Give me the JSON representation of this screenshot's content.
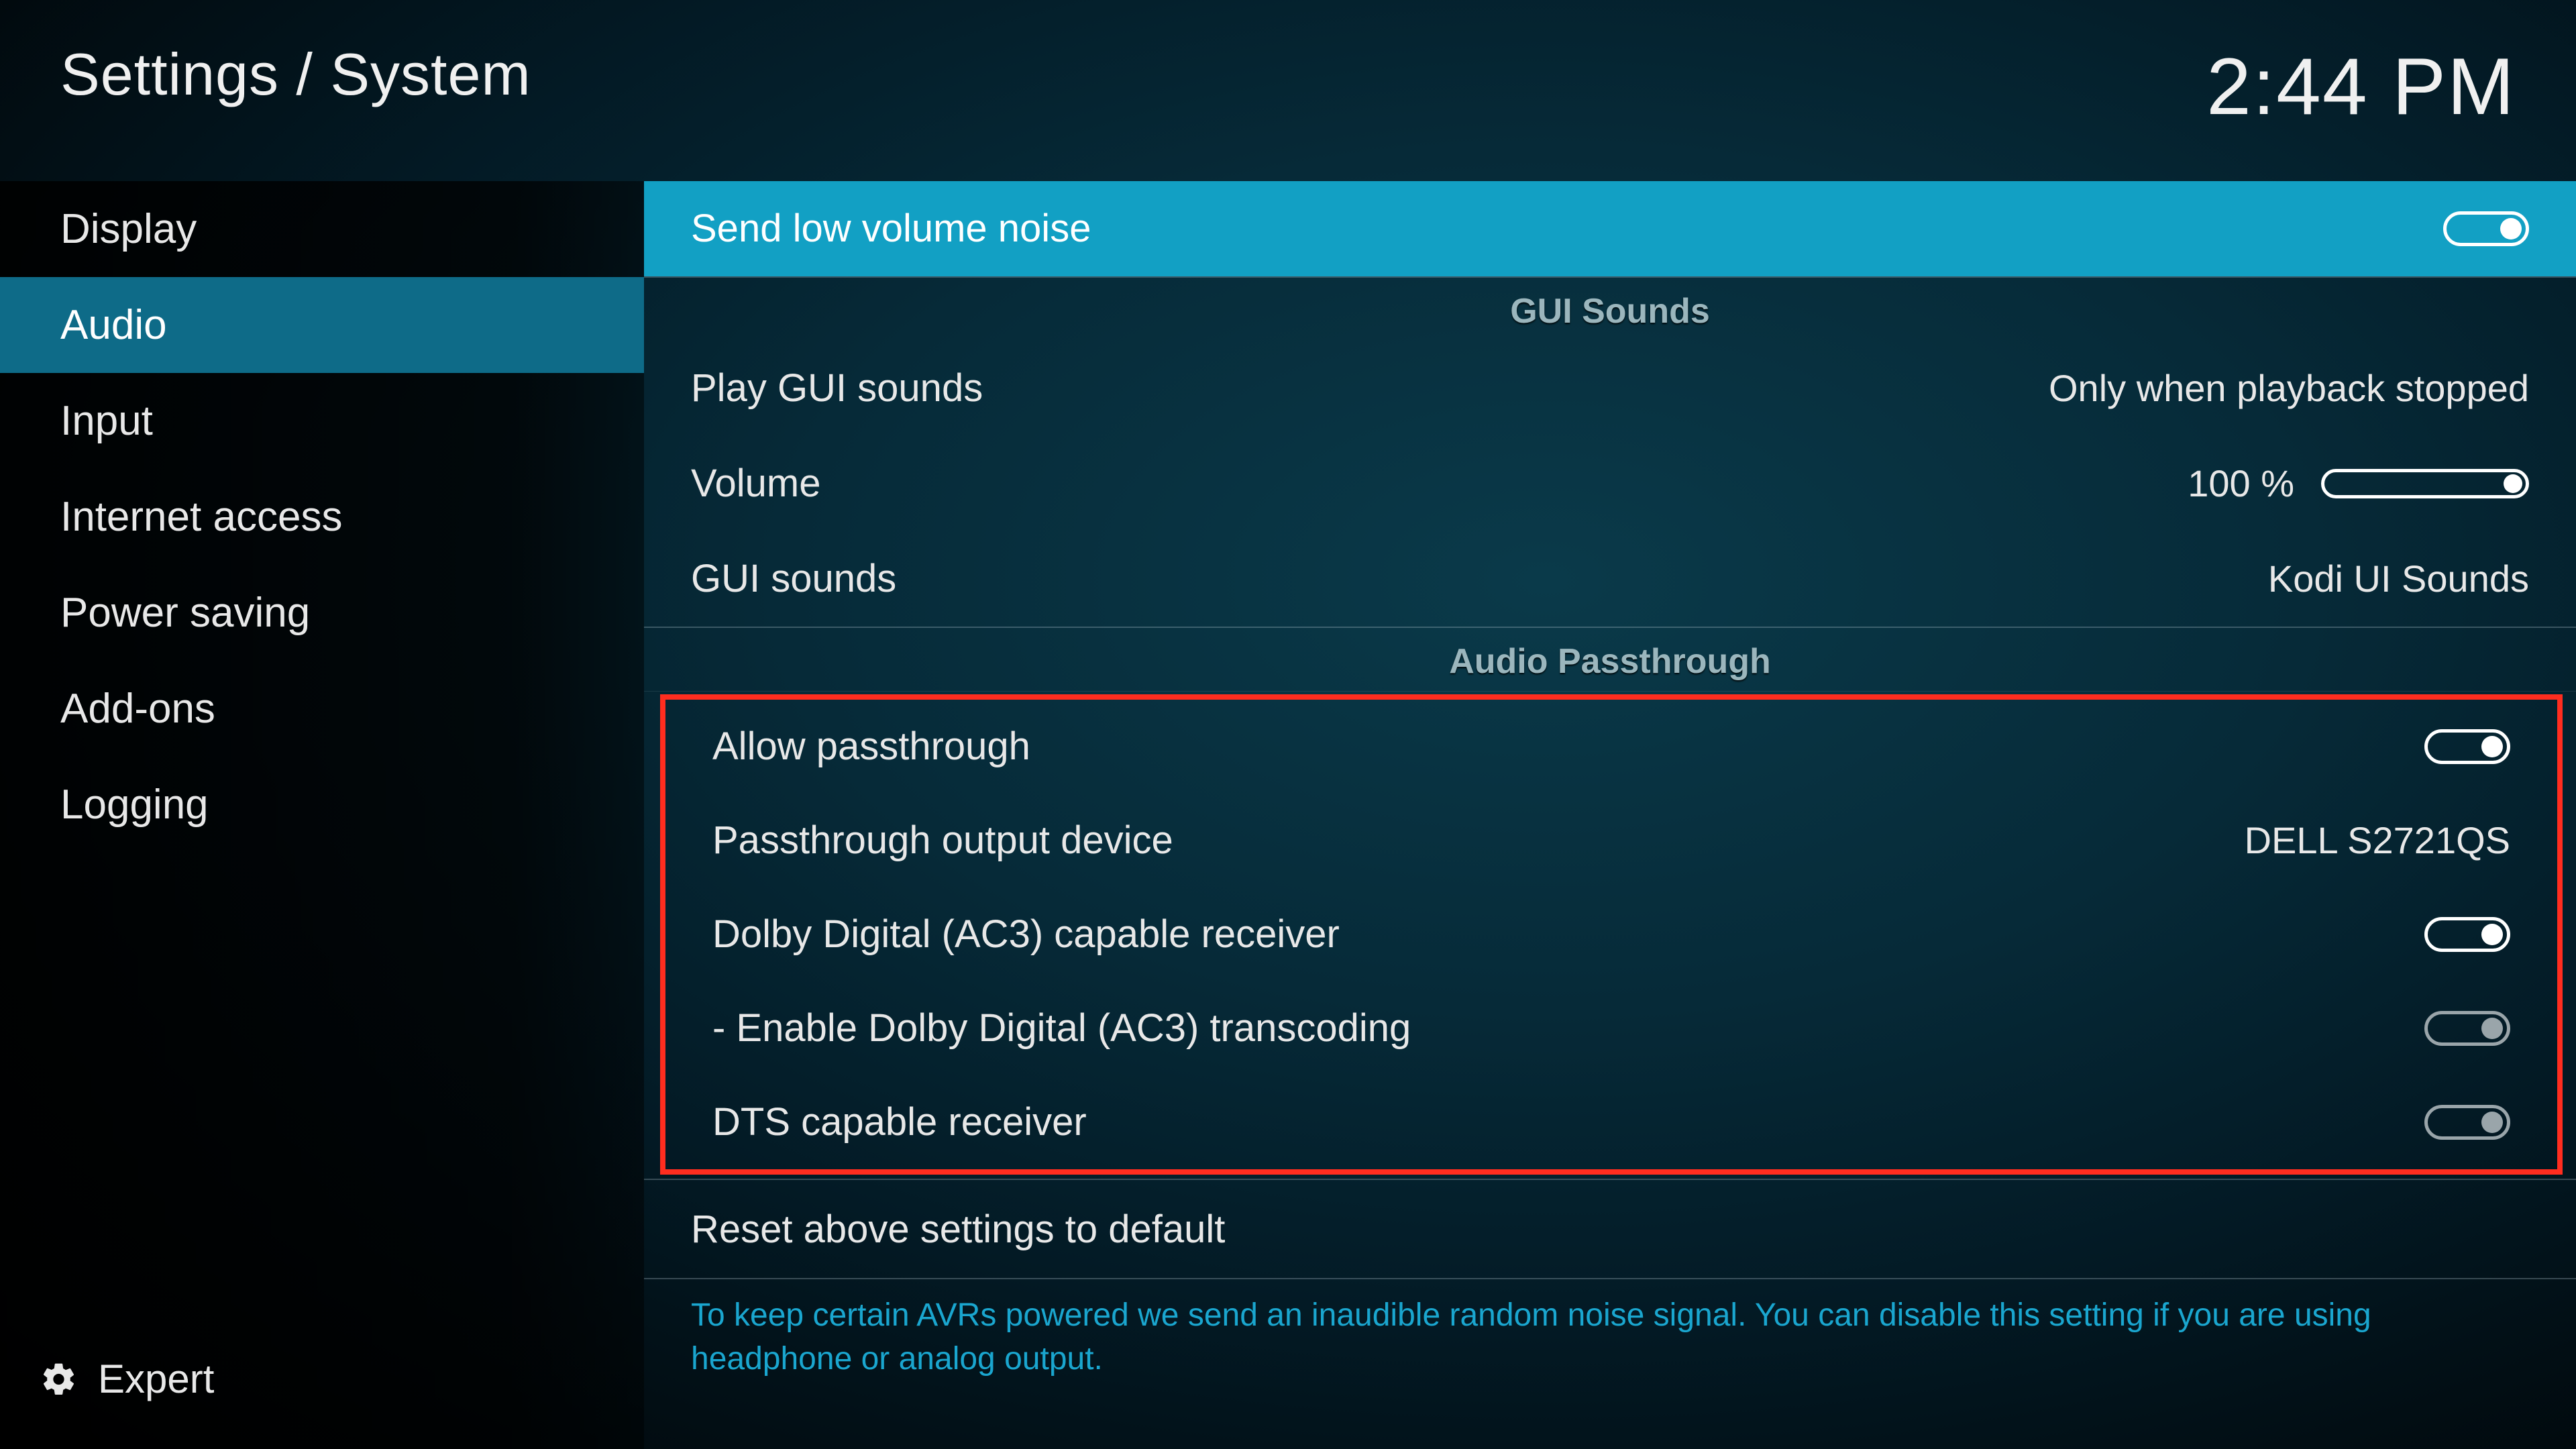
{
  "header": {
    "breadcrumb": "Settings / System",
    "clock": "2:44 PM"
  },
  "sidebar": {
    "items": [
      {
        "label": "Display"
      },
      {
        "label": "Audio"
      },
      {
        "label": "Input"
      },
      {
        "label": "Internet access"
      },
      {
        "label": "Power saving"
      },
      {
        "label": "Add-ons"
      },
      {
        "label": "Logging"
      }
    ],
    "active_index": 1,
    "level_label": "Expert"
  },
  "main": {
    "selected_row": {
      "label": "Send low volume noise",
      "toggle_on": true
    },
    "sections": [
      {
        "title": "GUI Sounds",
        "rows": [
          {
            "label": "Play GUI sounds",
            "value": "Only when playback stopped"
          },
          {
            "label": "Volume",
            "value": "100 %",
            "slider": true
          },
          {
            "label": "GUI sounds",
            "value": "Kodi UI Sounds"
          }
        ]
      },
      {
        "title": "Audio Passthrough",
        "highlighted": true,
        "rows": [
          {
            "label": "Allow passthrough",
            "toggle_on": true
          },
          {
            "label": "Passthrough output device",
            "value": "DELL S2721QS"
          },
          {
            "label": "Dolby Digital (AC3) capable receiver",
            "toggle_on": true
          },
          {
            "label": "- Enable Dolby Digital (AC3) transcoding",
            "toggle_on": false
          },
          {
            "label": "DTS capable receiver",
            "toggle_on": false
          }
        ]
      }
    ],
    "reset_label": "Reset above settings to default",
    "hint": "To keep certain AVRs powered we send an inaudible random noise signal. You can disable this setting if you are using headphone or analog output."
  }
}
